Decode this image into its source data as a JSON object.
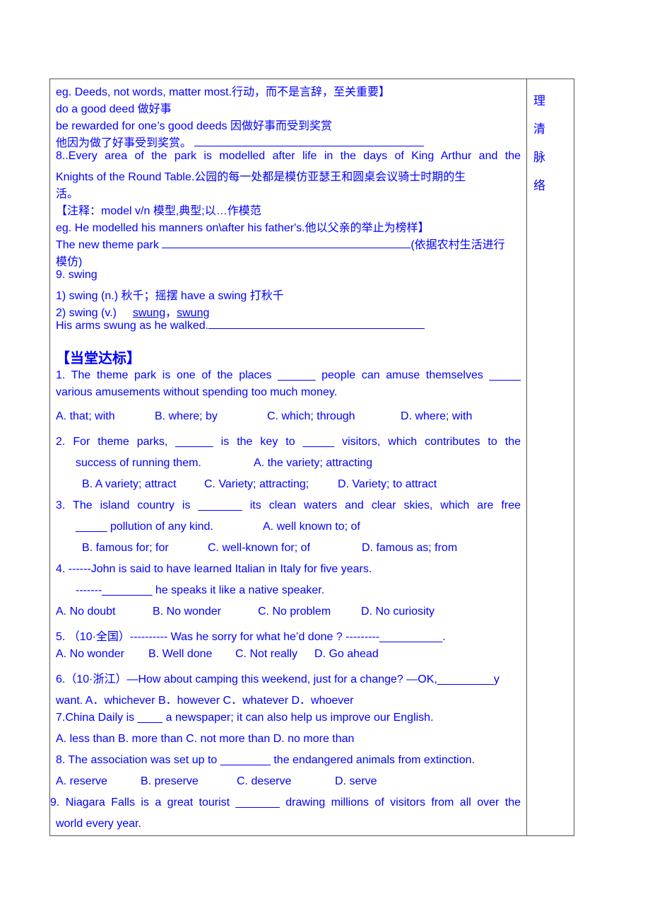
{
  "side_column": [
    "理",
    "清",
    "脉",
    "络"
  ],
  "notes": {
    "line1": "eg.    Deeds, not words, matter most.行动，而不是言辞，至关重要】",
    "line2": " do a good deed  做好事",
    "line3": "be rewarded for one’s good deeds  因做好事而受到奖赏",
    "line4": "他因为做了好事受到奖赏。",
    "item8_a": "8..Every    area of the park is modelled after life in the days of King Arthur and the",
    "item8_b": "Knights of the Round Table.公园的每一处都是模仿亚瑟王和圆桌会议骑士时期的生",
    "item8_c": "活。",
    "annot1": "【注释：model    v/n  模型,典型;以…作模范",
    "annot2": "eg.    He modelled his manners on\\after his father's.他以父亲的举止为榜样】",
    "park_a": "The new theme park",
    "park_hint": "(依据农村生活进行",
    "park_b": "模仿)",
    "item9": "9. swing",
    "swing1": "1) swing (n.)  秋千；摇摆  have a swing  打秋千",
    "swing2_prefix": "2) swing (v.)",
    "swing2_past": "swung",
    "swing2_sep": "，",
    "swing2_pp": "swung",
    "arms": "His arms swung as he walked."
  },
  "section_title": "【当堂达标】",
  "questions": {
    "q1_a": "1.    The theme park is one of the places ______ people can amuse themselves _____",
    "q1_b": "various amusements without spending too much money.",
    "q1_opts": [
      "A. that; with",
      "B. where; by",
      "C. which; through",
      "D. where; with"
    ],
    "q2_a": "2.    For theme parks, ______ is the key to _____ visitors, which contributes to the",
    "q2_b": "success of running them.",
    "q2_optA": "A.    the variety;    attracting",
    "q2_opts": [
      "B. A variety; attract",
      "C. Variety; attracting;",
      "D. Variety; to attract"
    ],
    "q3_a": "3.    The island country is _______ its clean waters and clear skies, which are free",
    "q3_b": "_____ pollution of any kind.",
    "q3_optA": "A. well known to; of",
    "q3_opts": [
      "B. famous for; for",
      "C. well-known for;    of",
      "D.    famous as; from"
    ],
    "q4_a": "4.    ------John is said to have learned Italian in Italy for five years.",
    "q4_b": "-------________ he speaks it like a native speaker.",
    "q4_opts": [
      "A. No doubt",
      "B. No wonder",
      "C. No problem",
      "D. No curiosity"
    ],
    "q5_a": "5. （10·全国）---------- Was he sorry for what he’d done ?        ---------__________.",
    "q5_opts": [
      "A. No wonder",
      "B. Well done",
      "C. Not really",
      "D. Go ahead"
    ],
    "q6_a": "6.（10·浙江）—How about camping this weekend, just for a change? —OK,_________y",
    "q6_b": "want. A．whichever  B．however            C．whatever      D．whoever",
    "q7_a": "7.China Daily is ____ a newspaper; it can also help us improve our English.",
    "q7_b": "A. less than      B. more than C. not more than D. no more than",
    "q8_a": "8. The association was set up to ________ the endangered animals from extinction.",
    "q8_opts": [
      "A.    reserve",
      "B.    preserve",
      "C.    deserve",
      "D.    serve"
    ],
    "q9_a": "9. Niagara Falls is a great tourist _______ drawing millions of visitors from all over the",
    "q9_b": "world every year."
  }
}
